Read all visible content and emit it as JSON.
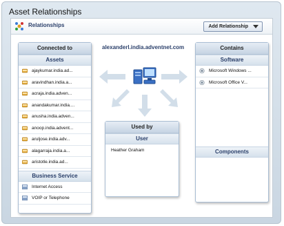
{
  "window": {
    "title": "Asset Relationships"
  },
  "toolbar": {
    "title": "Relationships",
    "add_button": "Add Relationship"
  },
  "host": "alexanderl.india.adventnet.com",
  "connected": {
    "header": "Connected to",
    "assets_header": "Assets",
    "assets": [
      "ajaykumar.india.ad...",
      "aravindhan.india.a...",
      "acraja.india.adven...",
      "anandakumar.india....",
      "anusha.india.adven...",
      "anoop.india.advent...",
      "aruljose.india.adv...",
      "alagarraja.india.a...",
      "aristotle.india.ad..."
    ],
    "business_header": "Business Service",
    "services": [
      "Internet Access",
      "VOIP or Telephone"
    ]
  },
  "used_by": {
    "header": "Used by",
    "sub_header": "User",
    "users": [
      "Heather Graham"
    ]
  },
  "contains": {
    "header": "Contains",
    "software_header": "Software",
    "software": [
      "Microsoft Windows ...",
      "Microsoft Office V..."
    ],
    "components_header": "Components"
  },
  "colors": {
    "accent": "#2a3f6a",
    "arrow": "#c8d6e4"
  }
}
